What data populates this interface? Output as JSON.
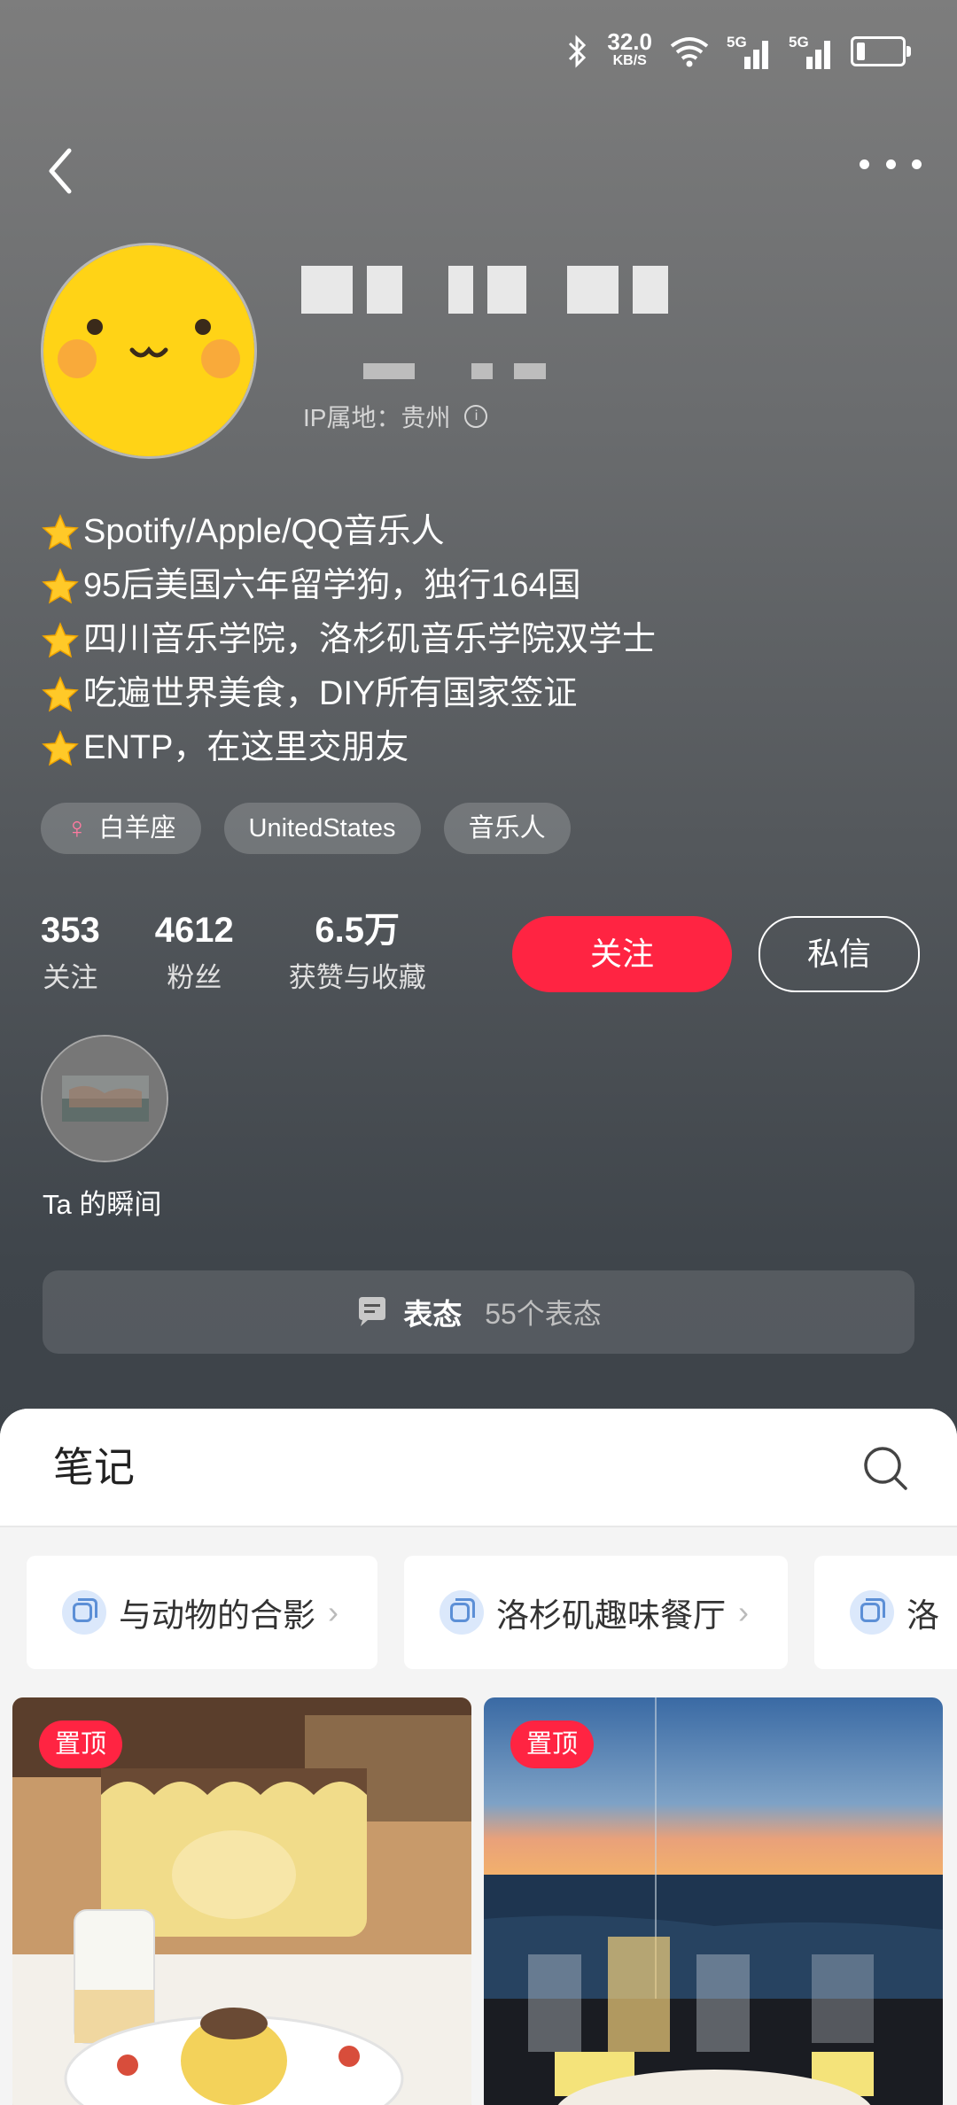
{
  "status_bar": {
    "speed_value": "32.0",
    "speed_unit": "KB/S",
    "sim1": "5G",
    "sim2": "5G",
    "battery_percent": 20
  },
  "profile": {
    "ip_label": "IP属地：贵州",
    "bio": [
      "Spotify/Apple/QQ音乐人",
      "95后美国六年留学狗，独行164国",
      "四川音乐学院，洛杉矶音乐学院双学士",
      "吃遍世界美食，DIY所有国家签证",
      "ENTP，在这里交朋友"
    ],
    "tags": [
      {
        "label": "白羊座",
        "icon": "female-icon"
      },
      {
        "label": "UnitedStates"
      },
      {
        "label": "音乐人"
      }
    ],
    "stats": [
      {
        "value": "353",
        "label": "关注"
      },
      {
        "value": "4612",
        "label": "粉丝"
      },
      {
        "value": "6.5万",
        "label": "获赞与收藏"
      }
    ],
    "follow_label": "关注",
    "message_label": "私信",
    "moments_label": "Ta 的瞬间",
    "biaotai_title": "表态",
    "biaotai_count": "55个表态"
  },
  "notes": {
    "title": "笔记",
    "collections": [
      {
        "label": "与动物的合影"
      },
      {
        "label": "洛杉矶趣味餐厅"
      },
      {
        "label": "洛"
      }
    ],
    "pinned_label": "置顶"
  },
  "colors": {
    "accent": "#ff2442",
    "collection_icon": "#5c8fd6"
  }
}
